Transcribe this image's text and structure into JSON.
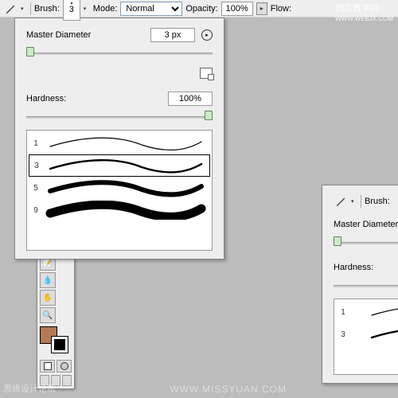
{
  "options_bar": {
    "brush_label": "Brush:",
    "brush_size": "3",
    "mode_label": "Mode:",
    "mode_value": "Normal",
    "opacity_label": "Opacity:",
    "opacity_value": "100%",
    "flow_label": "Flow:"
  },
  "brush_panel": {
    "diameter_label": "Master Diameter",
    "diameter_value": "3 px",
    "hardness_label": "Hardness:",
    "hardness_value": "100%",
    "brushes": [
      {
        "size": "1",
        "weight": 1.2,
        "selected": false
      },
      {
        "size": "3",
        "weight": 2.4,
        "selected": true
      },
      {
        "size": "5",
        "weight": 6,
        "selected": false
      },
      {
        "size": "9",
        "weight": 11,
        "selected": false
      }
    ]
  },
  "brush_panel2": {
    "brush_label": "Brush:",
    "diameter_label": "Master Diameter",
    "hardness_label": "Hardness:",
    "brushes": [
      {
        "size": "1",
        "weight": 1.2,
        "selected": false
      },
      {
        "size": "3",
        "weight": 2.4,
        "selected": false
      }
    ]
  },
  "colors": {
    "foreground": "#b37a58",
    "background": "#ffffff"
  },
  "watermarks": {
    "top": "网页教学网",
    "top_url": "WWW.WEBJX.COM",
    "bottom": "WWW.MISSYUAN.COM",
    "left": "思缘设计论坛"
  }
}
